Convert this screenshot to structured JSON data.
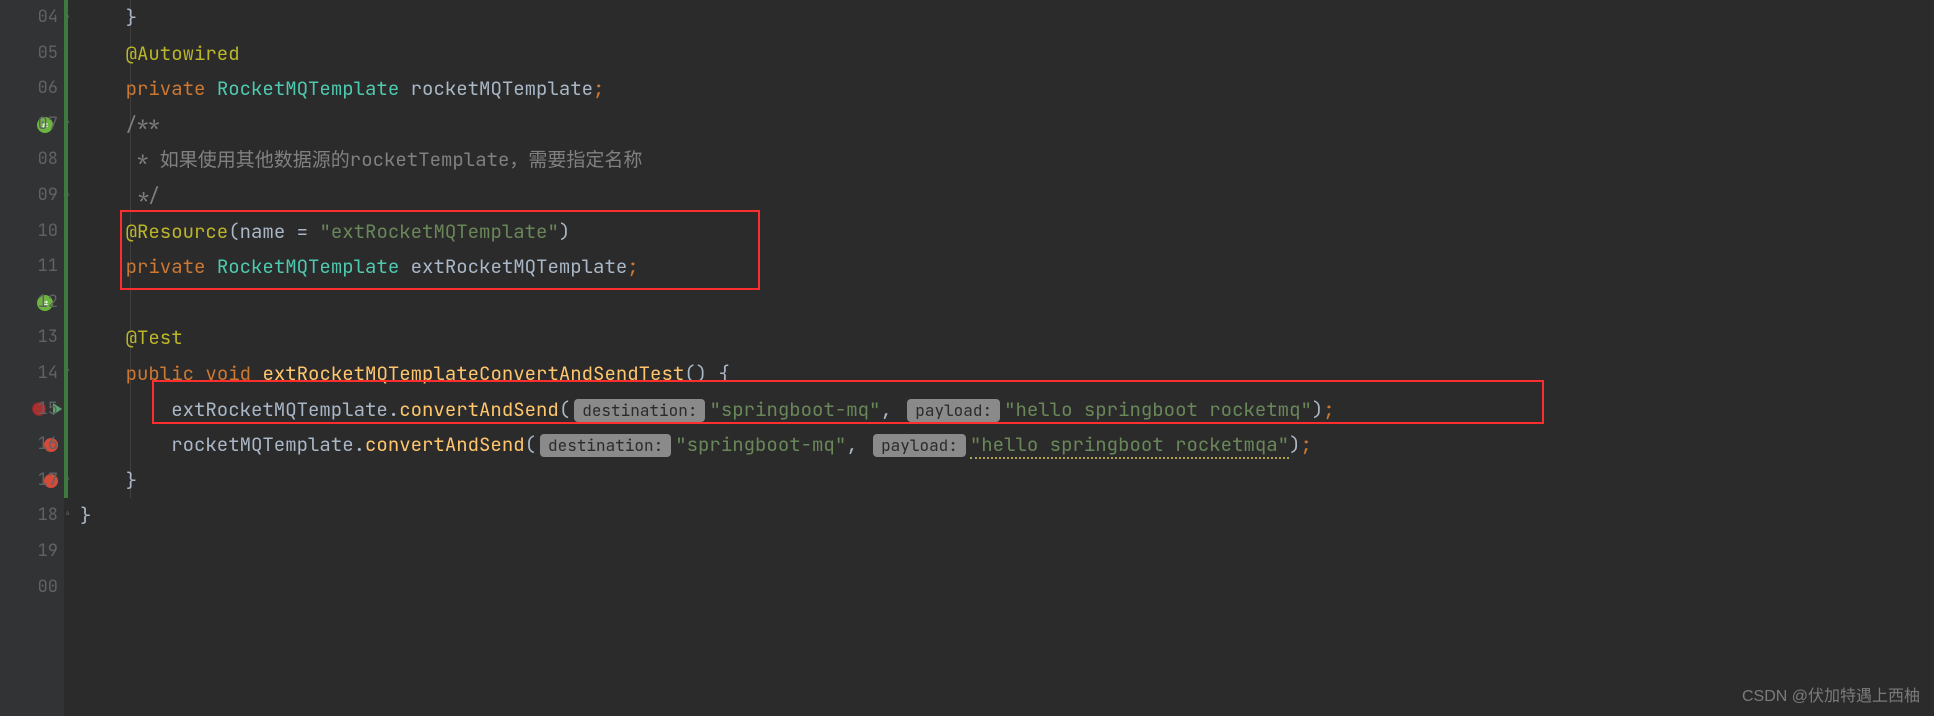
{
  "gutter": {
    "lines": [
      "04",
      "05",
      "06",
      "07",
      "08",
      "09",
      "10",
      "11",
      "12",
      "13",
      "14",
      "15",
      "16",
      "17",
      "18",
      "19",
      "00"
    ]
  },
  "code": {
    "l4": "    }",
    "l5_anno": "@Autowired",
    "l6_kw": "private",
    "l6_type": "RocketMQTemplate",
    "l6_id": "rocketMQTemplate",
    "l7": "/**",
    "l8": " * 如果使用其他数据源的rocketTemplate，需要指定名称",
    "l9": " */",
    "l10_anno": "@Resource",
    "l10_paren_a": "(",
    "l10_param": "name = ",
    "l10_str": "\"extRocketMQTemplate\"",
    "l10_paren_b": ")",
    "l11_kw": "private",
    "l11_type": "RocketMQTemplate",
    "l11_id": "extRocketMQTemplate",
    "l13_anno": "@Test",
    "l14_kw1": "public",
    "l14_kw2": "void",
    "l14_m": "extRocketMQTemplateConvertAndSendTest",
    "l14_tail": "() {",
    "l15_call_a": "extRocketMQTemplate",
    "l15_call_b": "convertAndSend",
    "l15_h1": "destination:",
    "l15_s1": "\"springboot-mq\"",
    "l15_h2": "payload:",
    "l15_s2": "\"hello springboot rocketmq\"",
    "l16_call_a": "rocketMQTemplate",
    "l16_call_b": "convertAndSend",
    "l16_h1": "destination:",
    "l16_s1": "\"springboot-mq\"",
    "l16_h2": "payload:",
    "l16_s2": "\"hello springboot rocketmqa\"",
    "l17": "    }",
    "l18": "}"
  },
  "watermark": "CSDN @伏加特遇上西柚"
}
